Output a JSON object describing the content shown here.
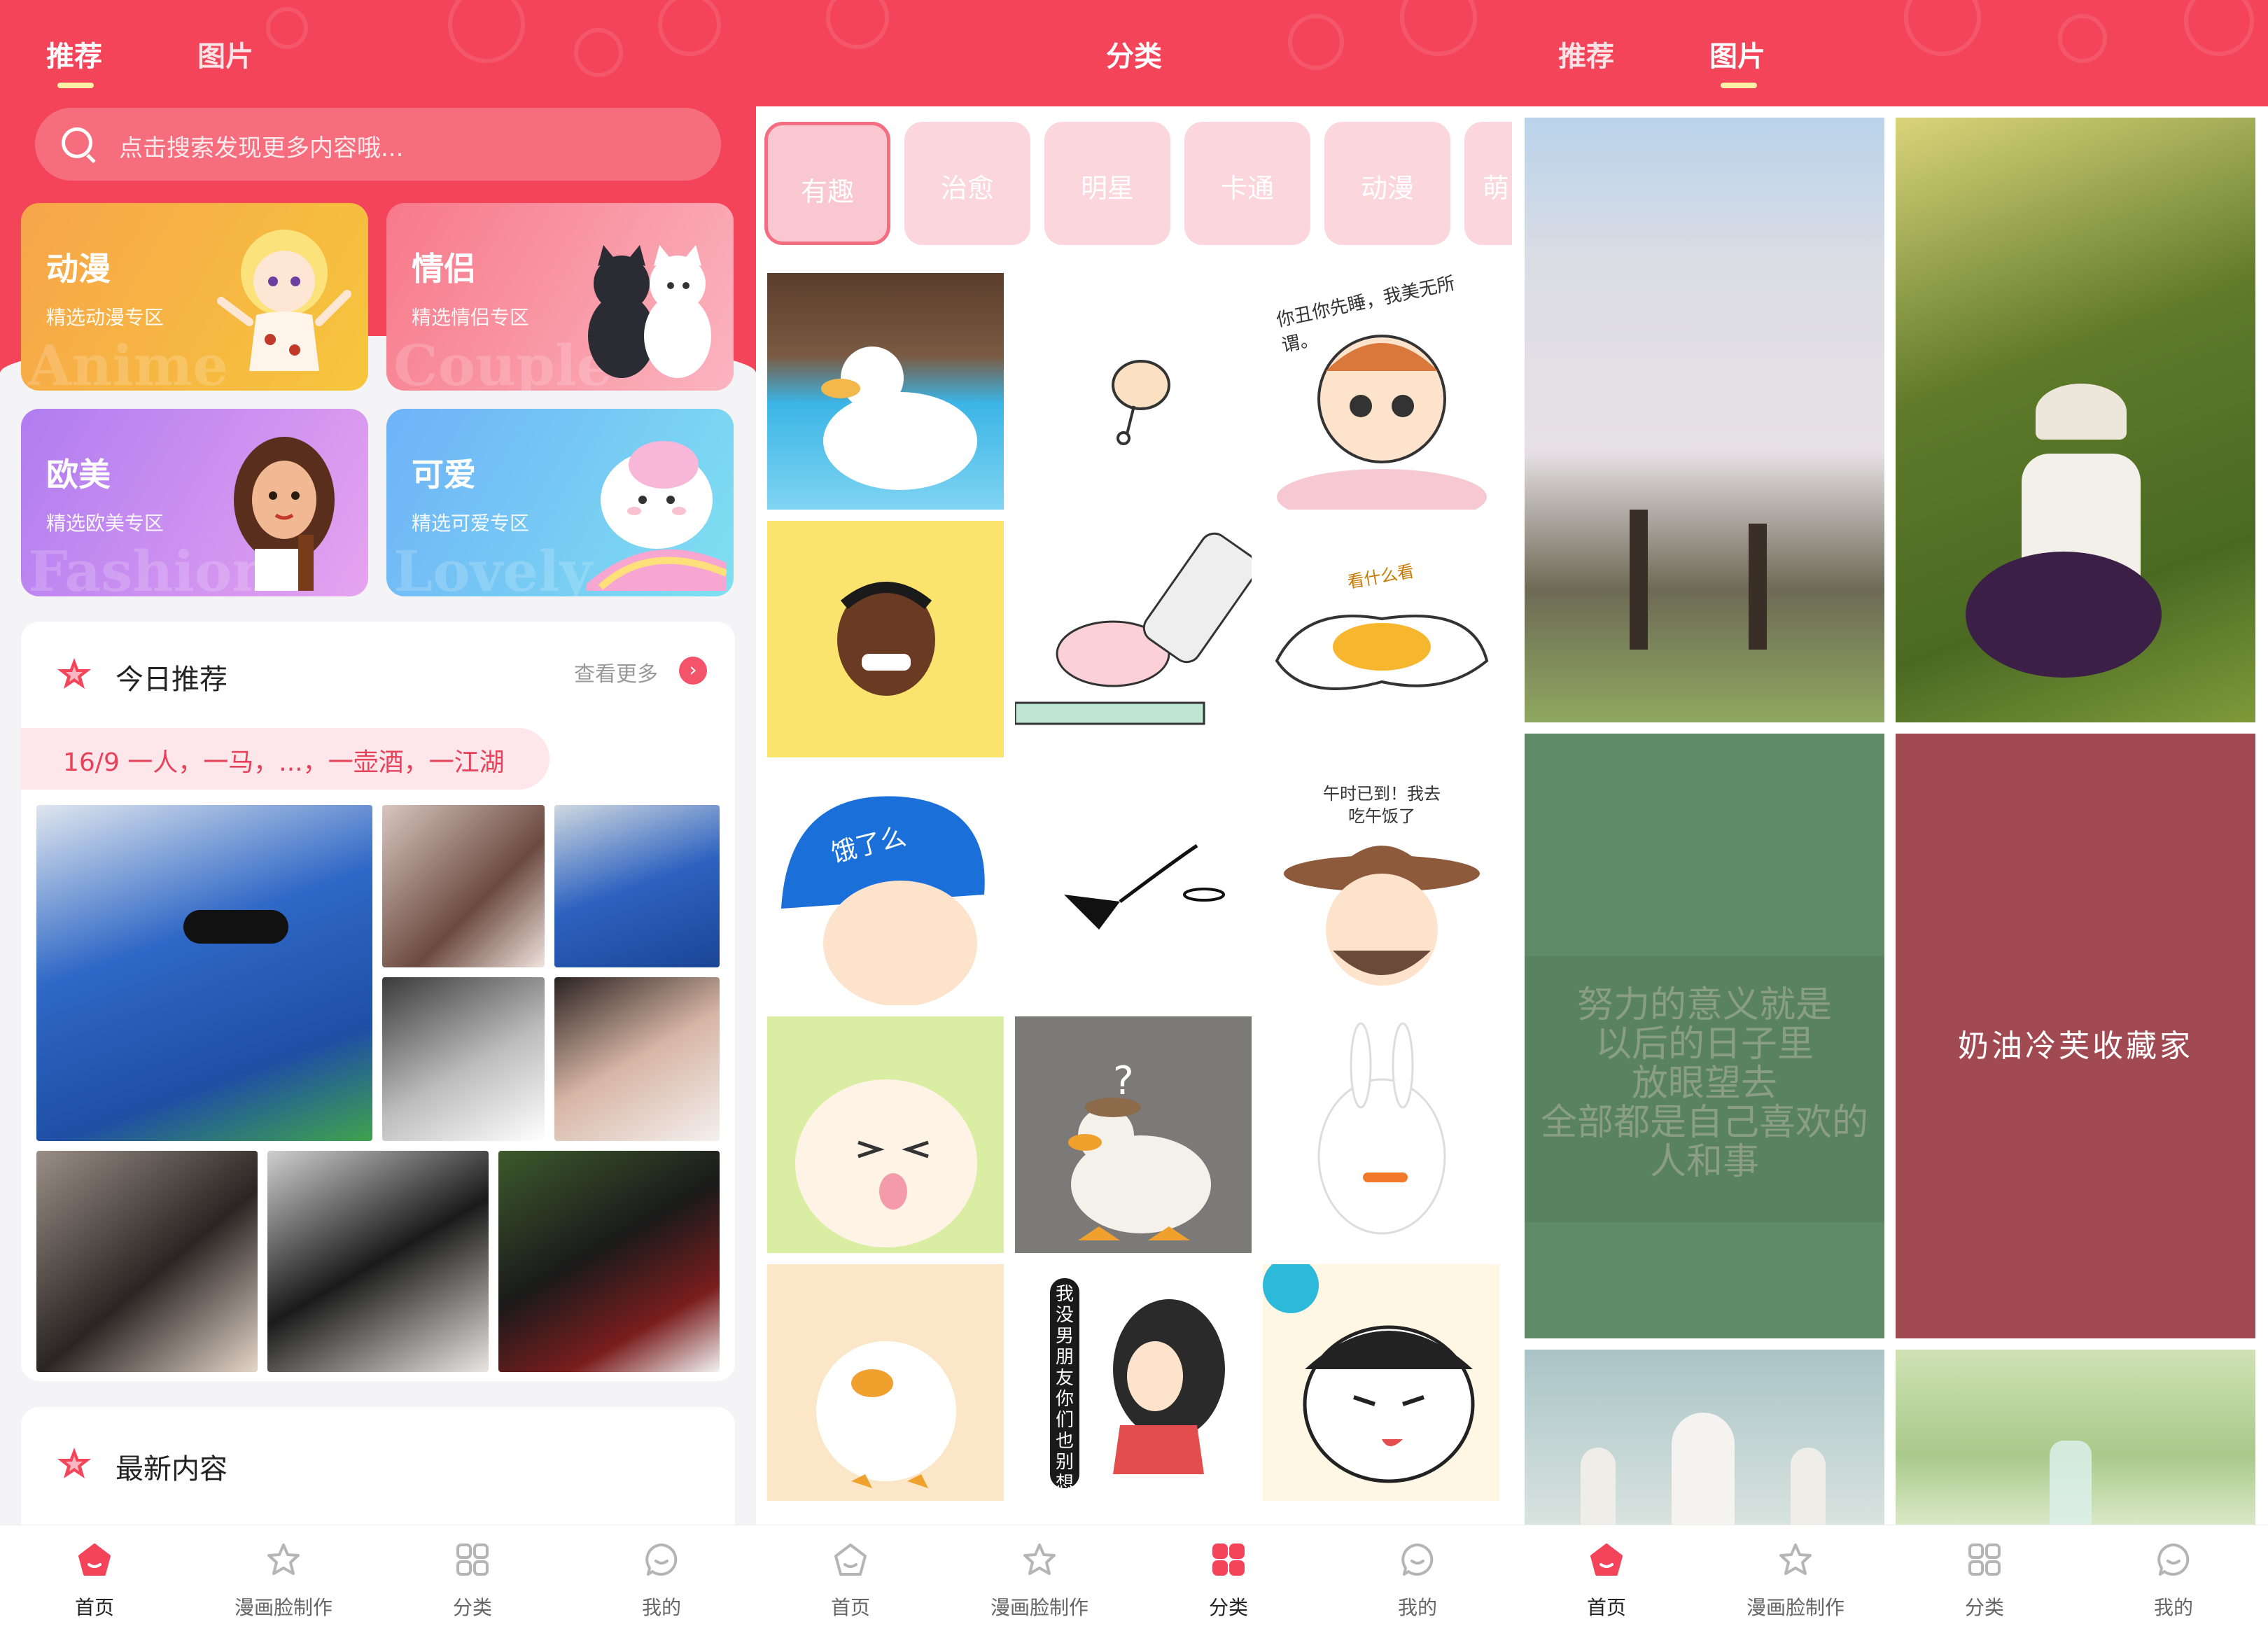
{
  "colors": {
    "brand": "#f4445a",
    "accent_soft": "#fde7ea",
    "chip": "#fbd6dc"
  },
  "screen1": {
    "tabs": [
      {
        "label": "推荐",
        "active": true
      },
      {
        "label": "图片",
        "active": false
      }
    ],
    "search": {
      "placeholder": "点击搜索发现更多内容哦..."
    },
    "categories": [
      {
        "title": "动漫",
        "subtitle": "精选动漫专区",
        "watermark": "Anime",
        "icon": "anime-girl-illustration"
      },
      {
        "title": "情侣",
        "subtitle": "精选情侣专区",
        "watermark": "Couple",
        "icon": "cats-couple-illustration"
      },
      {
        "title": "欧美",
        "subtitle": "精选欧美专区",
        "watermark": "Fashion",
        "icon": "western-girl-illustration"
      },
      {
        "title": "可爱",
        "subtitle": "精选可爱专区",
        "watermark": "Lovely",
        "icon": "unicorn-illustration"
      }
    ],
    "today": {
      "title": "今日推荐",
      "see_more": "查看更多",
      "date_quote": "16/9  一人，一马，...，一壶酒，一江湖"
    },
    "latest": {
      "title": "最新内容"
    }
  },
  "screen2": {
    "title": "分类",
    "chips": [
      {
        "label": "有趣",
        "active": true
      },
      {
        "label": "治愈"
      },
      {
        "label": "明星"
      },
      {
        "label": "卡通"
      },
      {
        "label": "动漫"
      },
      {
        "label": "萌"
      }
    ],
    "stickers": [
      {
        "name": "duck-pool",
        "caption": ""
      },
      {
        "name": "chicken-leg",
        "caption": ""
      },
      {
        "name": "sleepy-girl",
        "caption": "你丑你先睡，我美无所谓。"
      },
      {
        "name": "laughing-man",
        "caption": ""
      },
      {
        "name": "pig-toothpaste",
        "caption": ""
      },
      {
        "name": "egg-yolk",
        "caption": "看什么看"
      },
      {
        "name": "delivery-helmet",
        "caption": "饿了么"
      },
      {
        "name": "flying-doodle",
        "caption": ""
      },
      {
        "name": "cowboy-lunch",
        "caption": "午时已到！我去吃午饭了"
      },
      {
        "name": "anime-tongue",
        "caption": ""
      },
      {
        "name": "plush-duck",
        "caption": "?"
      },
      {
        "name": "rabbit-carrot",
        "caption": ""
      },
      {
        "name": "fluffy-duck",
        "caption": ""
      },
      {
        "name": "girl-vertical-text",
        "caption": "我没男朋友你们也别想有"
      },
      {
        "name": "round-face-boy",
        "caption": ""
      }
    ]
  },
  "screen3": {
    "tabs": [
      {
        "label": "推荐",
        "active": false
      },
      {
        "label": "图片",
        "active": true
      }
    ],
    "walls": [
      {
        "name": "cherry-blossom",
        "text": ""
      },
      {
        "name": "girl-in-field",
        "text": ""
      },
      {
        "name": "green-quote",
        "text": "努力的意义就是\n以后的日子里\n放眼望去\n全部都是自己喜欢的\n人和事"
      },
      {
        "name": "red-quote",
        "text": "奶油冷芙收藏家"
      },
      {
        "name": "church-domes",
        "text": ""
      },
      {
        "name": "green-bottle",
        "text": ""
      }
    ]
  },
  "nav": [
    {
      "label": "首页",
      "icon": "home-icon"
    },
    {
      "label": "漫画脸制作",
      "icon": "star-icon"
    },
    {
      "label": "分类",
      "icon": "grid-icon"
    },
    {
      "label": "我的",
      "icon": "smile-icon"
    }
  ],
  "nav_active": {
    "screen1": 0,
    "screen2": 2,
    "screen3": 0
  }
}
